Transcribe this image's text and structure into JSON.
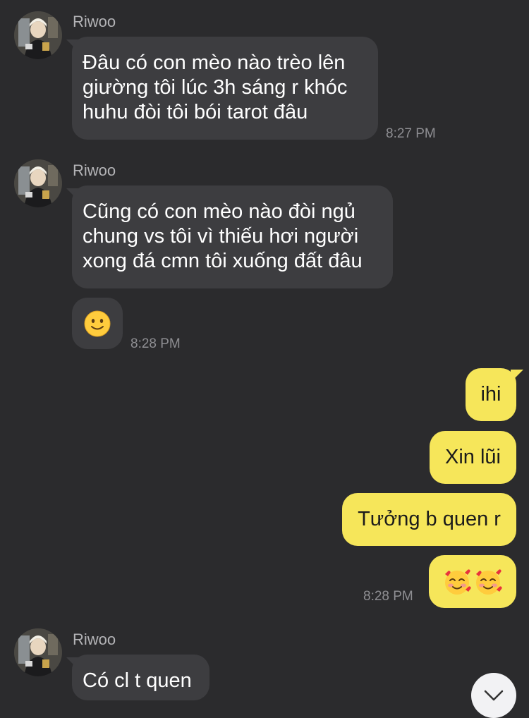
{
  "messages": {
    "m1": {
      "sender": "Riwoo",
      "lines": [
        "Đâu có con mèo nào trèo lên",
        "giường tôi lúc 3h sáng r khóc",
        "huhu đòi tôi bói tarot đâu"
      ],
      "time": "8:27 PM"
    },
    "m2": {
      "sender": "Riwoo",
      "lines": [
        "Cũng có con mèo nào đòi ngủ",
        "chung vs tôi vì thiếu hơi người",
        "xong đá cmn tôi xuống đất đâu"
      ],
      "emoji": "slightly-smiling-face",
      "time": "8:28 PM"
    },
    "out": {
      "items": [
        "ihi",
        "Xin lũi",
        "Tưởng b quen r"
      ],
      "emoji": "smiling-face-with-hearts x2",
      "time": "8:28 PM"
    },
    "m3": {
      "sender": "Riwoo",
      "text": "Có cl t quen"
    }
  },
  "colors": {
    "background": "#2b2b2d",
    "incoming_bubble": "#3d3d40",
    "outgoing_bubble": "#f6e65a",
    "timestamp": "#8e8e92"
  },
  "icons": {
    "scroll_down": "chevron-down-icon"
  }
}
